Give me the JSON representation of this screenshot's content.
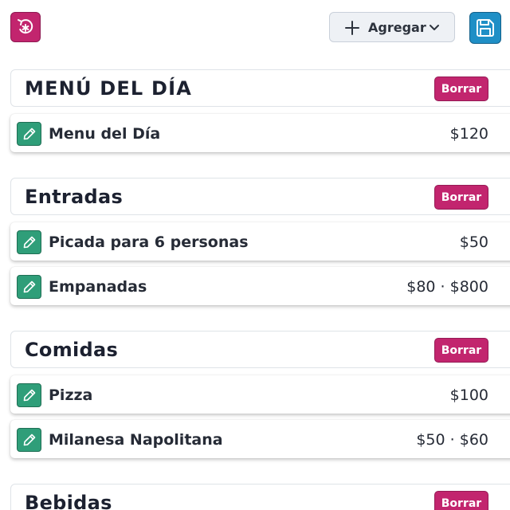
{
  "toolbar": {
    "reset_icon": "reset-asterisk-icon",
    "add_label": "Agregar",
    "add_icon": "plus-icon",
    "dropdown_icon": "chevron-down-icon",
    "save_icon": "save-icon"
  },
  "colors": {
    "primary": "#c2256e",
    "save": "#1f8fc6",
    "edit": "#2f9e79"
  },
  "delete_label": "Borrar",
  "categories": [
    {
      "title": "MENÚ DEL DÍA",
      "items": [
        {
          "name": "Menu del Día",
          "price": "$120"
        }
      ]
    },
    {
      "title": "Entradas",
      "items": [
        {
          "name": "Picada para 6 personas",
          "price": "$50"
        },
        {
          "name": "Empanadas",
          "price": "$80 · $800"
        }
      ]
    },
    {
      "title": "Comidas",
      "items": [
        {
          "name": "Pizza",
          "price": "$100"
        },
        {
          "name": "Milanesa Napolitana",
          "price": "$50 · $60"
        }
      ]
    },
    {
      "title": "Bebidas",
      "items": []
    }
  ]
}
